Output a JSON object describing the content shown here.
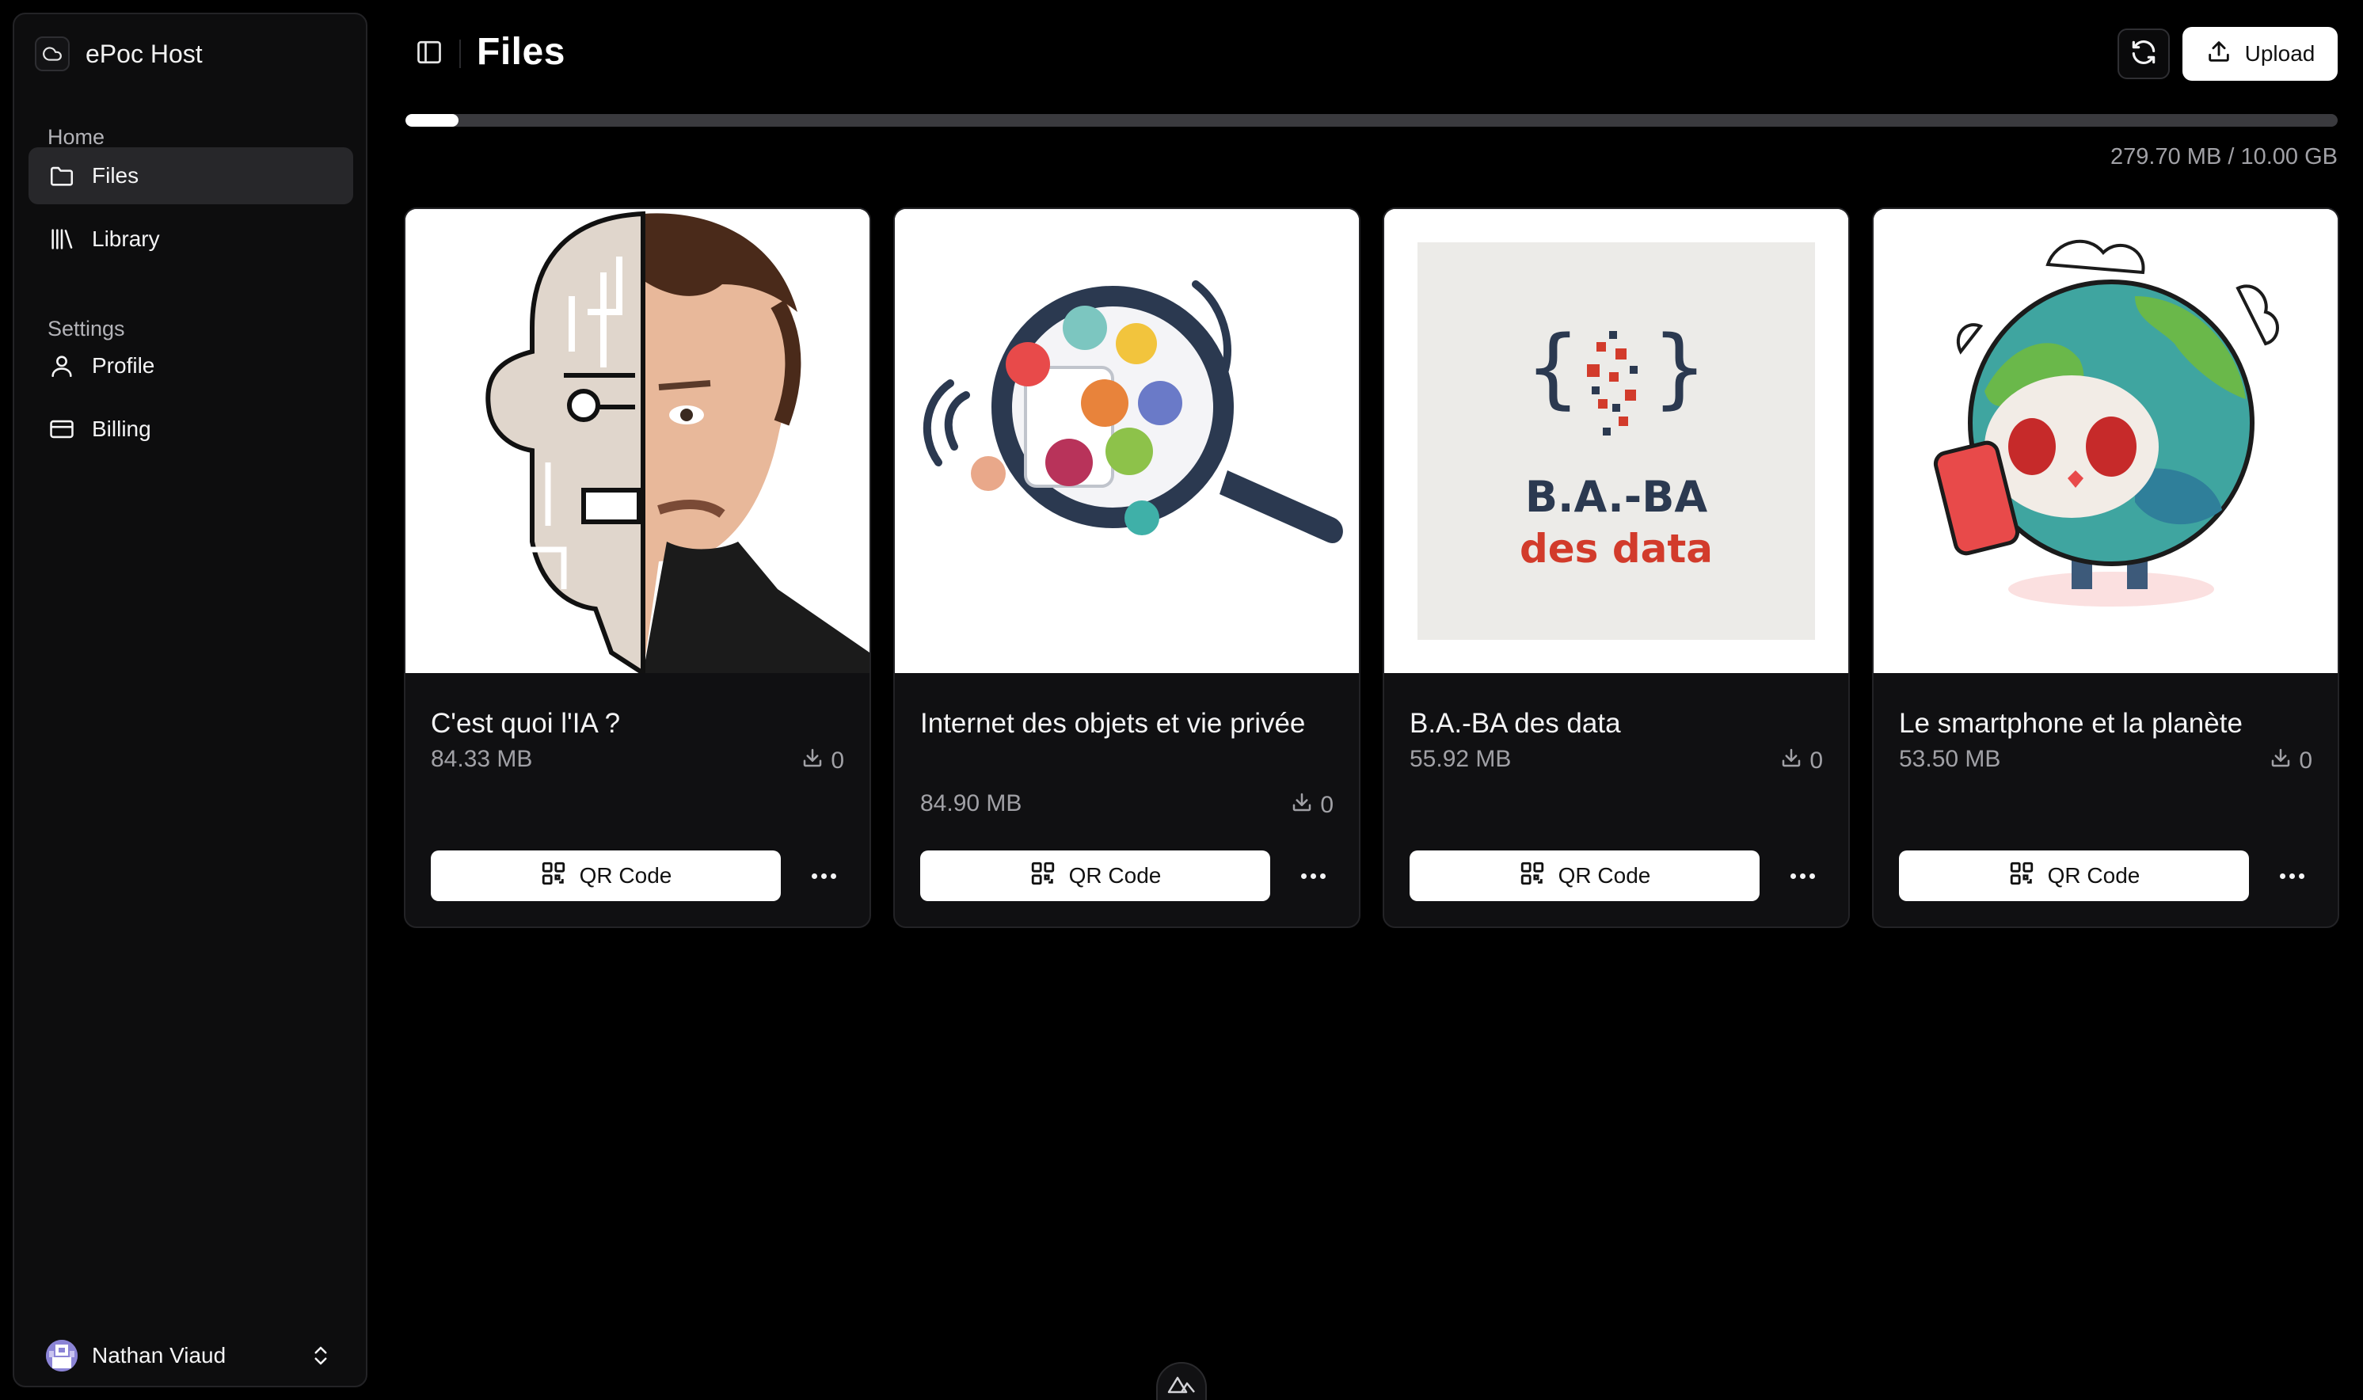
{
  "app": {
    "name": "ePoc Host"
  },
  "sidebar": {
    "sections": [
      {
        "title": "Home",
        "items": [
          {
            "label": "Files",
            "icon": "folder-icon",
            "active": true
          },
          {
            "label": "Library",
            "icon": "library-icon",
            "active": false
          }
        ]
      },
      {
        "title": "Settings",
        "items": [
          {
            "label": "Profile",
            "icon": "user-icon",
            "active": false
          },
          {
            "label": "Billing",
            "icon": "credit-card-icon",
            "active": false
          }
        ]
      }
    ],
    "user": {
      "name": "Nathan Viaud"
    }
  },
  "header": {
    "title": "Files",
    "upload_label": "Upload"
  },
  "storage": {
    "used_fraction": 0.0273,
    "label": "279.70 MB / 10.00 GB"
  },
  "files": [
    {
      "title": "C'est quoi l'IA ?",
      "size": "84.33 MB",
      "downloads": "0",
      "qr_label": "QR Code",
      "thumb": "ai-face"
    },
    {
      "title": "Internet des objets et vie privée",
      "size": "84.90 MB",
      "downloads": "0",
      "qr_label": "QR Code",
      "thumb": "magnifier"
    },
    {
      "title": "B.A.-BA des data",
      "size": "55.92 MB",
      "downloads": "0",
      "qr_label": "QR Code",
      "thumb": "data-logo",
      "thumb_text": {
        "line1": "B.A.-BA",
        "line2": "des data"
      }
    },
    {
      "title": "Le smartphone et la planète",
      "size": "53.50 MB",
      "downloads": "0",
      "qr_label": "QR Code",
      "thumb": "planet"
    }
  ],
  "colors": {
    "background": "#000000",
    "sidebar": "#0d0d0e",
    "card": "#101012",
    "active_nav": "#27272a",
    "muted_text": "#a1a1a6",
    "data_red": "#d23b2b",
    "data_navy": "#2b3950"
  }
}
